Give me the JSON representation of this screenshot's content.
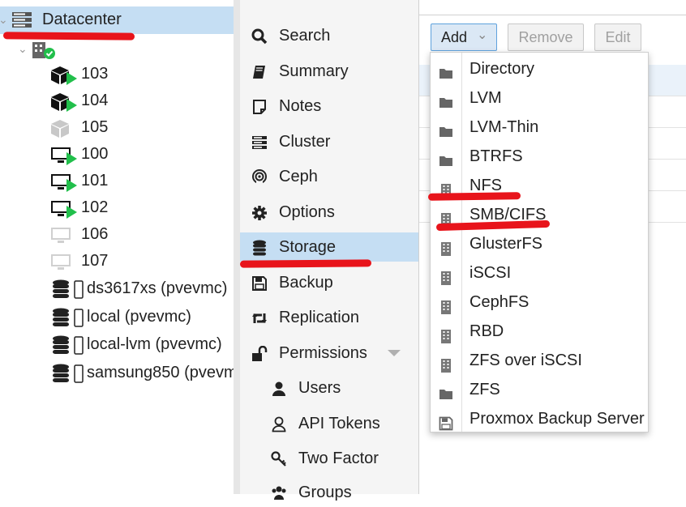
{
  "tree": {
    "datacenter": "Datacenter",
    "nodes": [
      {
        "id": "103",
        "type": "ct-running"
      },
      {
        "id": "104",
        "type": "ct-running"
      },
      {
        "id": "105",
        "type": "ct-stopped"
      },
      {
        "id": "100",
        "type": "vm-running"
      },
      {
        "id": "101",
        "type": "vm-running"
      },
      {
        "id": "102",
        "type": "vm-running"
      },
      {
        "id": "106",
        "type": "vm-stopped"
      },
      {
        "id": "107",
        "type": "vm-stopped"
      }
    ],
    "storages": [
      "ds3617xs (pvevmc)",
      "local (pvevmc)",
      "local-lvm (pvevmc)",
      "samsung850 (pvevm"
    ]
  },
  "nav": {
    "items": [
      {
        "label": "Search",
        "icon": "search-icon"
      },
      {
        "label": "Summary",
        "icon": "book-icon"
      },
      {
        "label": "Notes",
        "icon": "note-icon"
      },
      {
        "label": "Cluster",
        "icon": "server-icon"
      },
      {
        "label": "Ceph",
        "icon": "ceph-icon"
      },
      {
        "label": "Options",
        "icon": "gear-icon"
      },
      {
        "label": "Storage",
        "icon": "database-icon"
      },
      {
        "label": "Backup",
        "icon": "floppy-icon"
      },
      {
        "label": "Replication",
        "icon": "retweet-icon"
      },
      {
        "label": "Permissions",
        "icon": "unlock-icon"
      },
      {
        "label": "Users",
        "icon": "user-icon"
      },
      {
        "label": "API Tokens",
        "icon": "user-outline-icon"
      },
      {
        "label": "Two Factor",
        "icon": "key-icon"
      },
      {
        "label": "Groups",
        "icon": "users-icon"
      }
    ]
  },
  "toolbar": {
    "add": "Add",
    "remove": "Remove",
    "edit": "Edit"
  },
  "menu": {
    "items": [
      {
        "label": "Directory",
        "icon": "folder-icon"
      },
      {
        "label": "LVM",
        "icon": "folder-icon"
      },
      {
        "label": "LVM-Thin",
        "icon": "folder-icon"
      },
      {
        "label": "BTRFS",
        "icon": "folder-icon"
      },
      {
        "label": "NFS",
        "icon": "building-icon"
      },
      {
        "label": "SMB/CIFS",
        "icon": "building-icon"
      },
      {
        "label": "GlusterFS",
        "icon": "building-icon"
      },
      {
        "label": "iSCSI",
        "icon": "building-icon"
      },
      {
        "label": "CephFS",
        "icon": "building-icon"
      },
      {
        "label": "RBD",
        "icon": "building-icon"
      },
      {
        "label": "ZFS over iSCSI",
        "icon": "building-icon"
      },
      {
        "label": "ZFS",
        "icon": "folder-icon"
      },
      {
        "label": "Proxmox Backup Server",
        "icon": "floppy-icon"
      }
    ]
  },
  "colors": {
    "selected": "#c5def3",
    "annotation": "#e8141b",
    "running": "#21bf4b"
  }
}
